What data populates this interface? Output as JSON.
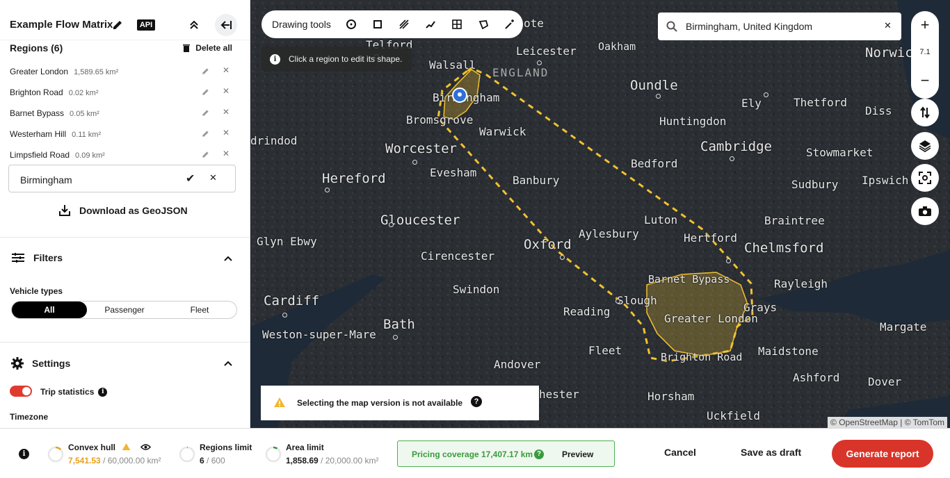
{
  "header": {
    "title": "Example Flow Matrix",
    "api_label": "API"
  },
  "regions": {
    "title": "Regions (6)",
    "delete_all": "Delete all",
    "items": [
      {
        "name": "Greater London",
        "area": "1,589.65 km²"
      },
      {
        "name": "Brighton Road",
        "area": "0.02 km²"
      },
      {
        "name": "Barnet Bypass",
        "area": "0.05 km²"
      },
      {
        "name": "Westerham Hill",
        "area": "0.11 km²"
      },
      {
        "name": "Limpsfield Road",
        "area": "0.09 km²"
      }
    ],
    "new_region_value": "Birmingham",
    "download_label": "Download as GeoJSON"
  },
  "filters": {
    "title": "Filters",
    "vehicle_types_label": "Vehicle types",
    "options": [
      "All",
      "Passenger",
      "Fleet"
    ],
    "selected": "All"
  },
  "settings": {
    "title": "Settings",
    "trip_statistics_label": "Trip statistics",
    "timezone_label": "Timezone"
  },
  "map": {
    "drawing_tools_label": "Drawing tools",
    "hint": "Click a region to edit its shape.",
    "search_value": "Birmingham, United Kingdom",
    "zoom_level": "7.1",
    "warning": "Selecting the map version is not available",
    "attribution": "© OpenStreetMap | © TomTom",
    "country_label": "ENGLAND",
    "cities": [
      {
        "name": "Telford",
        "size": "mid"
      },
      {
        "name": "Leicester",
        "size": "mid"
      },
      {
        "name": "Oakham",
        "size": "sm"
      },
      {
        "name": "Norwich",
        "size": "big"
      },
      {
        "name": "Walsall",
        "size": "mid"
      },
      {
        "name": "Birmingham",
        "size": "mid"
      },
      {
        "name": "Oundle",
        "size": "big"
      },
      {
        "name": "Ely",
        "size": "mid"
      },
      {
        "name": "Thetford",
        "size": "mid"
      },
      {
        "name": "Diss",
        "size": "mid"
      },
      {
        "name": "Bromsgrove",
        "size": "mid"
      },
      {
        "name": "Warwick",
        "size": "mid"
      },
      {
        "name": "Huntingdon",
        "size": "mid"
      },
      {
        "name": "drindod",
        "size": "mid"
      },
      {
        "name": "Worcester",
        "size": "big"
      },
      {
        "name": "Cambridge",
        "size": "big"
      },
      {
        "name": "Stowmarket",
        "size": "mid"
      },
      {
        "name": "Evesham",
        "size": "mid"
      },
      {
        "name": "Bedford",
        "size": "mid"
      },
      {
        "name": "Hereford",
        "size": "big"
      },
      {
        "name": "Banbury",
        "size": "mid"
      },
      {
        "name": "Sudbury",
        "size": "mid"
      },
      {
        "name": "Ipswich",
        "size": "mid"
      },
      {
        "name": "Gloucester",
        "size": "big"
      },
      {
        "name": "Luton",
        "size": "mid"
      },
      {
        "name": "Braintree",
        "size": "mid"
      },
      {
        "name": "Aylesbury",
        "size": "mid"
      },
      {
        "name": "Glyn Ebwy",
        "size": "mid"
      },
      {
        "name": "Oxford",
        "size": "big"
      },
      {
        "name": "Hertford",
        "size": "mid"
      },
      {
        "name": "Chelmsford",
        "size": "big"
      },
      {
        "name": "Cirencester",
        "size": "mid"
      },
      {
        "name": "Barnet Bypass",
        "size": "sm"
      },
      {
        "name": "Rayleigh",
        "size": "mid"
      },
      {
        "name": "Swindon",
        "size": "mid"
      },
      {
        "name": "Cardiff",
        "size": "big"
      },
      {
        "name": "Slough",
        "size": "mid"
      },
      {
        "name": "Reading",
        "size": "mid"
      },
      {
        "name": "Grays",
        "size": "mid"
      },
      {
        "name": "Greater London",
        "size": "mid"
      },
      {
        "name": "Bath",
        "size": "big"
      },
      {
        "name": "Margate",
        "size": "mid"
      },
      {
        "name": "Weston-super-Mare",
        "size": "mid"
      },
      {
        "name": "Fleet",
        "size": "mid"
      },
      {
        "name": "Maidstone",
        "size": "mid"
      },
      {
        "name": "Brighton Road",
        "size": "sm"
      },
      {
        "name": "Andover",
        "size": "mid"
      },
      {
        "name": "Ashford",
        "size": "mid"
      },
      {
        "name": "Dover",
        "size": "mid"
      },
      {
        "name": "hester",
        "size": "mid"
      },
      {
        "name": "Horsham",
        "size": "mid"
      },
      {
        "name": "Uckfield",
        "size": "mid"
      },
      {
        "name": "ote",
        "size": "mid"
      }
    ]
  },
  "footer": {
    "convex_hull_label": "Convex hull",
    "convex_hull_value": "7,541.53",
    "convex_hull_limit": "/ 60,000.00 km²",
    "convex_hull_fraction": 0.126,
    "regions_limit_label": "Regions limit",
    "regions_limit_value": "6",
    "regions_limit_limit": "/ 600",
    "regions_limit_fraction": 0.01,
    "area_limit_label": "Area limit",
    "area_limit_value": "1,858.69",
    "area_limit_limit": "/ 20,000.00 km²",
    "area_limit_fraction": 0.093,
    "pricing_label": "Pricing coverage",
    "pricing_value": "17,407.17 km",
    "preview_label": "Preview",
    "cancel_label": "Cancel",
    "save_draft_label": "Save as draft",
    "generate_label": "Generate report"
  },
  "colors": {
    "accent_red": "#d93429",
    "toggle_on": "#e03a2e",
    "pricing_green": "#3a9a3e",
    "region_outline": "#f2c230"
  }
}
